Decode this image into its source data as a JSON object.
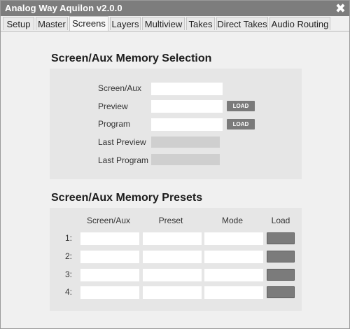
{
  "window": {
    "title": "Analog Way Aquilon v2.0.0"
  },
  "tabs": [
    {
      "label": "Setup"
    },
    {
      "label": "Master"
    },
    {
      "label": "Screens",
      "active": true
    },
    {
      "label": "Layers"
    },
    {
      "label": "Multiview"
    },
    {
      "label": "Takes"
    },
    {
      "label": "Direct Takes"
    },
    {
      "label": "Audio Routing"
    }
  ],
  "memory_selection": {
    "title": "Screen/Aux Memory Selection",
    "rows": [
      {
        "label": "Screen/Aux",
        "value": ""
      },
      {
        "label": "Preview",
        "value": "",
        "button": "LOAD"
      },
      {
        "label": "Program",
        "value": "",
        "button": "LOAD"
      },
      {
        "label": "Last Preview",
        "value": ""
      },
      {
        "label": "Last Program",
        "value": ""
      }
    ]
  },
  "memory_presets": {
    "title": "Screen/Aux Memory Presets",
    "columns": [
      "Screen/Aux",
      "Preset",
      "Mode",
      "Load"
    ],
    "rows": [
      {
        "num": "1:",
        "screen": "",
        "preset": "",
        "mode": ""
      },
      {
        "num": "2:",
        "screen": "",
        "preset": "",
        "mode": ""
      },
      {
        "num": "3:",
        "screen": "",
        "preset": "",
        "mode": ""
      },
      {
        "num": "4:",
        "screen": "",
        "preset": "",
        "mode": ""
      }
    ]
  },
  "colors": {
    "titlebar": "#7d7d7d",
    "panel": "#e6e6e6",
    "button": "#7a7a7a"
  }
}
